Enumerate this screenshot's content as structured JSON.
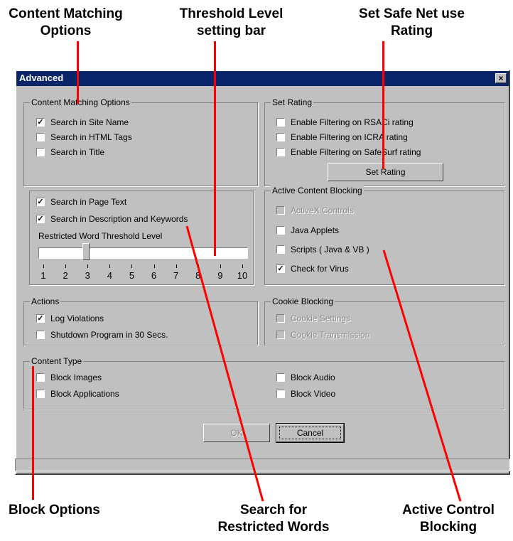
{
  "callouts": {
    "content_matching": [
      "Content Matching",
      "Options"
    ],
    "threshold": [
      "Threshold Level",
      "setting bar"
    ],
    "safe_net": [
      "Set Safe Net use",
      "Rating"
    ],
    "block_options": "Block Options",
    "search_restricted": [
      "Search for",
      "Restricted Words"
    ],
    "active_control": [
      "Active Control",
      "Blocking"
    ]
  },
  "dialog": {
    "title": "Advanced",
    "close_glyph": "×"
  },
  "groups": {
    "content_matching": {
      "legend": "Content Matching Options",
      "items": [
        {
          "label": "Search in Site Name",
          "checked": true
        },
        {
          "label": "Search in HTML Tags",
          "checked": false
        },
        {
          "label": "Search in Title",
          "checked": false
        }
      ]
    },
    "page_text": {
      "items": [
        {
          "label": "Search in Page Text",
          "checked": true
        },
        {
          "label": "Search in Description and Keywords",
          "checked": true
        }
      ],
      "threshold_label": "Restricted Word Threshold Level",
      "threshold_value": 3,
      "ticks": [
        "1",
        "2",
        "3",
        "4",
        "5",
        "6",
        "7",
        "8",
        "9",
        "10"
      ]
    },
    "set_rating": {
      "legend": "Set Rating",
      "items": [
        {
          "label": "Enable Filtering on RSACi rating",
          "checked": false
        },
        {
          "label": "Enable Filtering on ICRA rating",
          "checked": false
        },
        {
          "label": "Enable Filtering on SafeSurf rating",
          "checked": false
        }
      ],
      "button": "Set Rating"
    },
    "active_content": {
      "legend": "Active Content Blocking",
      "items": [
        {
          "label": "ActiveX Controls",
          "checked": false,
          "disabled": true
        },
        {
          "label": "Java Applets",
          "checked": false
        },
        {
          "label": "Scripts ( Java & VB )",
          "checked": false
        },
        {
          "label": "Check for Virus",
          "checked": true
        }
      ]
    },
    "actions": {
      "legend": "Actions",
      "items": [
        {
          "label": "Log Violations",
          "checked": true
        },
        {
          "label": "Shutdown Program in 30 Secs.",
          "checked": false
        }
      ]
    },
    "cookie": {
      "legend": "Cookie Blocking",
      "items": [
        {
          "label": "Cookie Settings",
          "checked": false,
          "disabled": true
        },
        {
          "label": "Cookie Transmission",
          "checked": false,
          "disabled": true
        }
      ]
    },
    "content_type": {
      "legend": "Content Type",
      "items": [
        {
          "label": "Block Images",
          "checked": false
        },
        {
          "label": "Block Applications",
          "checked": false
        },
        {
          "label": "Block Audio",
          "checked": false
        },
        {
          "label": "Block Video",
          "checked": false
        }
      ]
    }
  },
  "buttons": {
    "ok": "OK",
    "cancel": "Cancel"
  },
  "check_glyph": "✓",
  "colors": {
    "titlebar": "#0a246a",
    "pointer": "#ff0000",
    "face": "#c0c0c0"
  }
}
